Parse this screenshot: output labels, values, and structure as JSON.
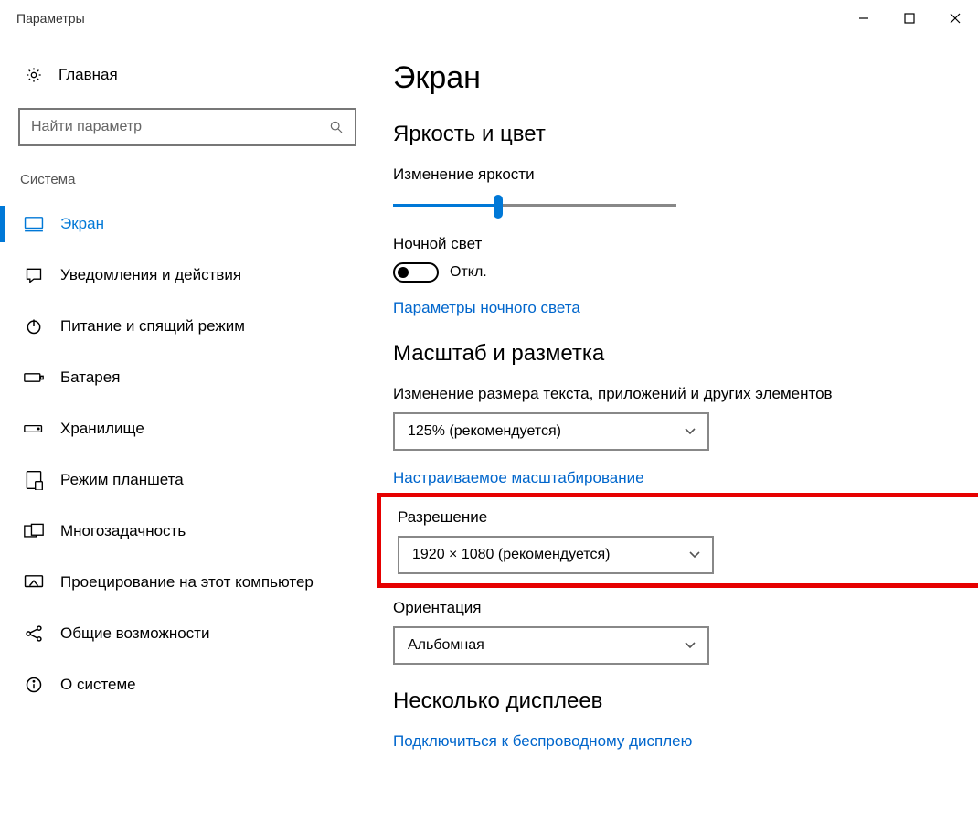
{
  "window": {
    "title": "Параметры"
  },
  "sidebar": {
    "home_label": "Главная",
    "search_placeholder": "Найти параметр",
    "category_label": "Система",
    "items": [
      {
        "label": "Экран",
        "active": true
      },
      {
        "label": "Уведомления и действия"
      },
      {
        "label": "Питание и спящий режим"
      },
      {
        "label": "Батарея"
      },
      {
        "label": "Хранилище"
      },
      {
        "label": "Режим планшета"
      },
      {
        "label": "Многозадачность"
      },
      {
        "label": "Проецирование на этот компьютер"
      },
      {
        "label": "Общие возможности"
      },
      {
        "label": "О системе"
      }
    ]
  },
  "main": {
    "heading": "Экран",
    "section_brightness": "Яркость и цвет",
    "brightness_label": "Изменение яркости",
    "night_light_label": "Ночной свет",
    "toggle_off_text": "Откл.",
    "night_light_settings_link": "Параметры ночного света",
    "section_scale": "Масштаб и разметка",
    "scale_label": "Изменение размера текста, приложений и других элементов",
    "scale_value": "125% (рекомендуется)",
    "custom_scaling_link": "Настраиваемое масштабирование",
    "resolution_label": "Разрешение",
    "resolution_value": "1920 × 1080 (рекомендуется)",
    "orientation_label": "Ориентация",
    "orientation_value": "Альбомная",
    "section_multi": "Несколько дисплеев",
    "wireless_link": "Подключиться к беспроводному дисплею"
  }
}
